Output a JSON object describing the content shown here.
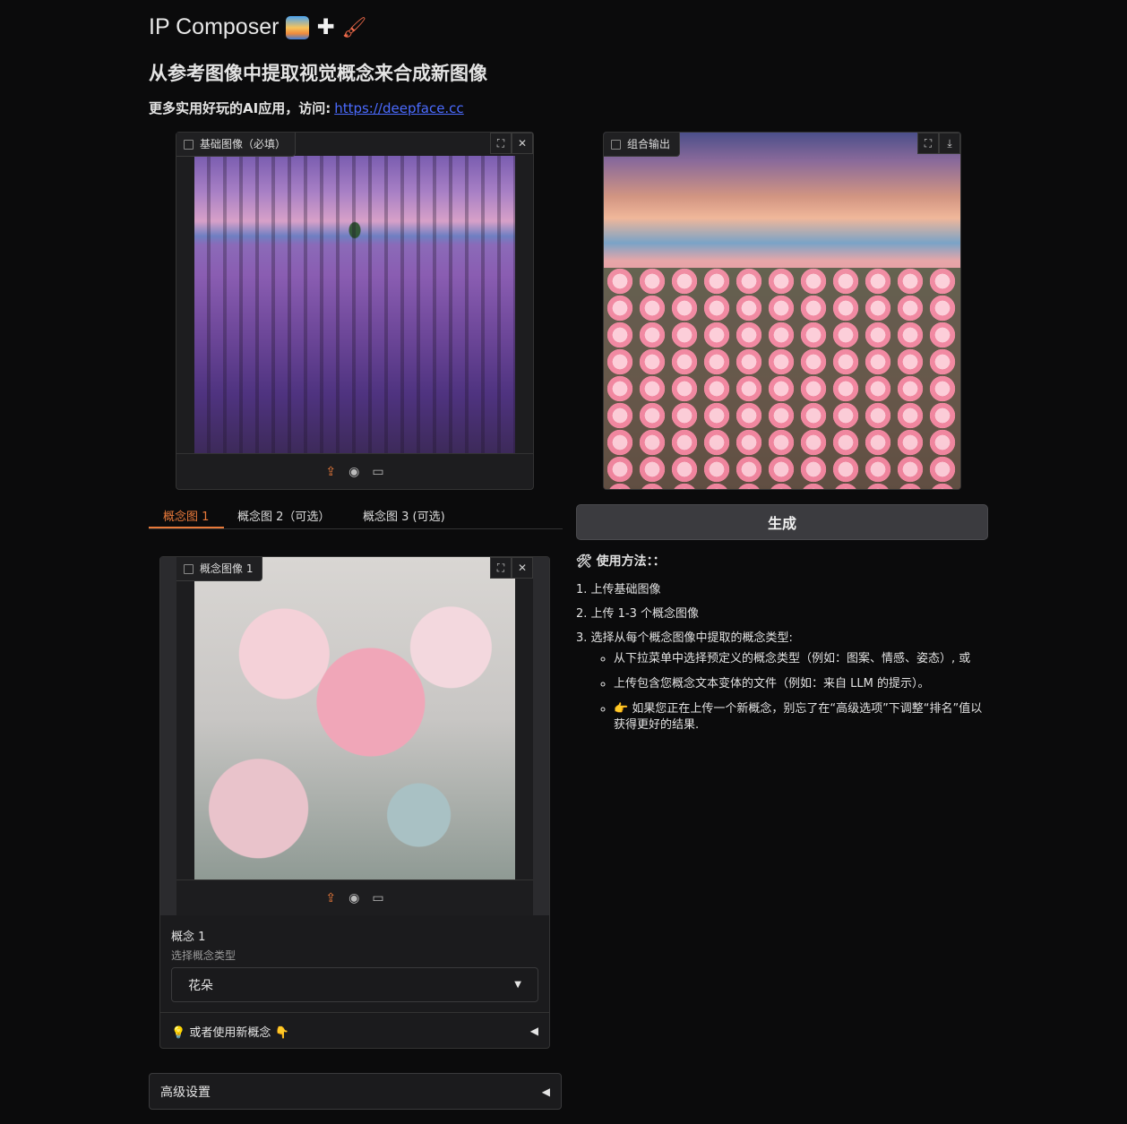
{
  "header": {
    "title": "IP Composer",
    "subtitle": "从参考图像中提取视觉概念来合成新图像",
    "more_text": "更多实用好玩的AI应用，访问:",
    "more_link": "https://deepface.cc"
  },
  "base_image": {
    "label": "基础图像（必填）"
  },
  "output_image": {
    "label": "组合输出"
  },
  "tabs": [
    "概念图 1",
    "概念图 2（可选）",
    "概念图 3 (可选)"
  ],
  "concept": {
    "image_label": "概念图像 1",
    "name": "概念 1",
    "type_label": "选择概念类型",
    "type_value": "花朵",
    "new_concept": "或者使用新概念"
  },
  "advanced": "高级设置",
  "generate_label": "生成",
  "usage": {
    "title": "使用方法：：",
    "steps": [
      "1. 上传基础图像",
      "2. 上传 1-3 个概念图像",
      "3. 选择从每个概念图像中提取的概念类型:"
    ],
    "bullets": [
      "从下拉菜单中选择预定义的概念类型（例如：图案、情感、姿态）, 或",
      "上传包含您概念文本变体的文件（例如：来自 LLM 的提示）。",
      "如果您正在上传一个新概念，别忘了在“高级选项”下调整“排名”值以获得更好的结果."
    ]
  },
  "colors": {
    "accent": "#e8793a",
    "link": "#4b6bff",
    "background": "#0b0b0c"
  },
  "icons": [
    "image-icon",
    "fullscreen-icon",
    "close-icon",
    "download-icon",
    "upload-icon",
    "webcam-icon",
    "clipboard-icon",
    "dropdown-caret-icon",
    "collapse-arrow-icon",
    "tools-icon",
    "bulb-icon",
    "point-down-icon",
    "point-right-icon"
  ]
}
